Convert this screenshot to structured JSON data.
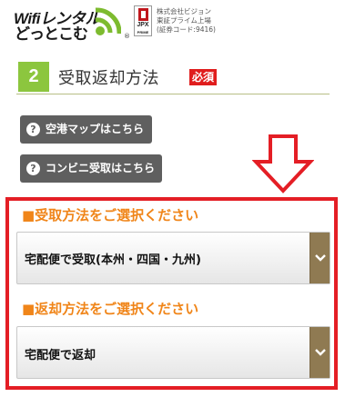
{
  "header": {
    "logo": {
      "line1": "Wifiレンタル",
      "line2": "どっとこむ",
      "reg_mark": "®",
      "icon": "wifi-wave-icon"
    },
    "listing": {
      "mark_line1": "JPX",
      "mark_line2": "PRIME"
    },
    "company_lines": [
      "株式会社ビジョン",
      "東証プライム上場",
      "(証券コード:9416)"
    ]
  },
  "section": {
    "number": "2",
    "title": "受取返却方法",
    "required_badge": "必須"
  },
  "buttons": {
    "airport_map": "空港マップはこちら",
    "convenience_pickup": "コンビニ受取はこちら",
    "help_icon_glyph": "?"
  },
  "pickup": {
    "label": "■受取方法をご選択ください",
    "selected": "宅配便で受取(本州・四国・九州)"
  },
  "return": {
    "label": "■返却方法をご選択ください",
    "selected": "宅配便で返却"
  },
  "colors": {
    "section_number_bg": "#8cc63e",
    "required_bg": "#e01d1d",
    "frame_red": "#e41e25",
    "label_orange": "#f08519",
    "select_arrow_bg": "#8f7a52",
    "gray_button": "#5f5f5f"
  }
}
